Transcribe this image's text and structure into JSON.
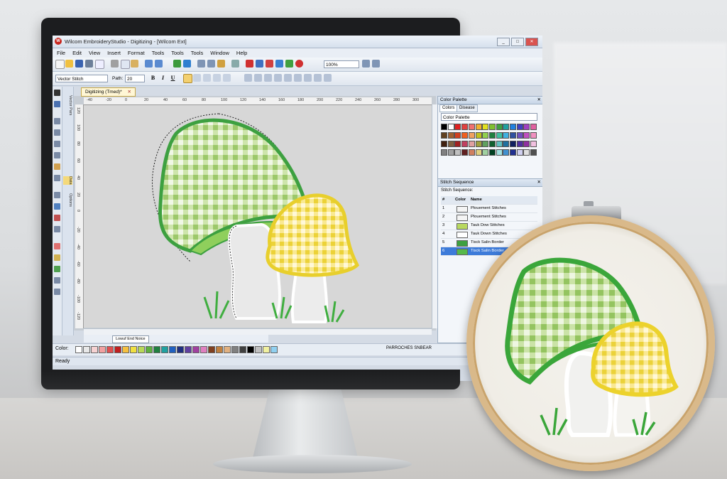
{
  "app": {
    "title": "Wilcom EmbroideryStudio - Digitizing - [Wilcom Ext]",
    "logo_text": "W",
    "window_buttons": [
      "_",
      "□",
      "✕"
    ]
  },
  "menu": [
    "File",
    "Edit",
    "View",
    "Insert",
    "Format",
    "Tools",
    "Tools",
    "Tools",
    "Window",
    "Help"
  ],
  "toolbar": {
    "zoom_value": "100%",
    "stitch_type": "Vector Stitch",
    "path_label": "Path:",
    "path_value": "20",
    "bold": "B",
    "italic": "I",
    "underline": "U"
  },
  "document": {
    "tab_label": "Digitizing (Tmed)*",
    "tab_close": "✕",
    "sheet_tab": "Lowuf End Noice",
    "side_tabs": [
      "Vector Pars",
      "Data",
      "Options"
    ]
  },
  "rulers": {
    "top": [
      "-40",
      "-20",
      "0",
      "20",
      "40",
      "60",
      "80",
      "100",
      "120",
      "140",
      "160",
      "180",
      "200",
      "220",
      "240",
      "260",
      "280",
      "300"
    ],
    "left": [
      "120",
      "100",
      "80",
      "60",
      "40",
      "20",
      "0",
      "-20",
      "-40",
      "-60",
      "-80",
      "-100",
      "-120"
    ]
  },
  "colorbar": {
    "label": "Color:",
    "colors": [
      "#ffffff",
      "#e8e8e8",
      "#f6d2d2",
      "#f2a0a0",
      "#e05050",
      "#c02020",
      "#f5c040",
      "#f0e040",
      "#b8d858",
      "#60b040",
      "#208040",
      "#20a0a0",
      "#2060c0",
      "#203080",
      "#6040a0",
      "#a040a0",
      "#e080c0",
      "#804020",
      "#c08040",
      "#e0b080",
      "#808080",
      "#404040",
      "#000000",
      "#c0c0c0",
      "#f0f0a0",
      "#90d0f0"
    ],
    "right_label": "PARROCHES SNBEAR"
  },
  "status": {
    "text": "Ready"
  },
  "color_palette": {
    "title": "Color Palette",
    "tabs": [
      "Colors",
      "Disease"
    ],
    "dropdown": "Color Palette",
    "swatches": [
      "#000000",
      "#ffffff",
      "#e02020",
      "#e04040",
      "#f07070",
      "#f0b030",
      "#e0e020",
      "#80c030",
      "#40a040",
      "#20a0a0",
      "#2080e0",
      "#4040c0",
      "#a040c0",
      "#e060a0",
      "#604020",
      "#a06030",
      "#d04020",
      "#f06020",
      "#f0a060",
      "#c0c020",
      "#90d050",
      "#208040",
      "#40c0a0",
      "#40b0e0",
      "#3050a0",
      "#7050c0",
      "#c050c0",
      "#f090c0",
      "#402010",
      "#806040",
      "#a02020",
      "#c04060",
      "#e0a0a0",
      "#a0a040",
      "#60a060",
      "#106030",
      "#60c0c0",
      "#2070a0",
      "#102060",
      "#5030a0",
      "#9030a0",
      "#f0c0e0",
      "#808080",
      "#a0a0a0",
      "#c0c0c0",
      "#602020",
      "#d08060",
      "#e0d080",
      "#a0d0a0",
      "#004020",
      "#a0e0e0",
      "#4090d0",
      "#203090",
      "#d0d0f0",
      "#e0e0e0",
      "#505050"
    ]
  },
  "stitch_sequence": {
    "title": "Stitch Sequence",
    "subtitle": "Stitch Sequence:",
    "headers": [
      "#",
      "Color",
      "Name"
    ],
    "rows": [
      {
        "num": "1",
        "swatch": "#f4f4f4",
        "name": "Plouement Stitches"
      },
      {
        "num": "2",
        "swatch": "#f4f4f4",
        "name": "Plouement Stitches"
      },
      {
        "num": "3",
        "swatch": "#b8d860",
        "name": "Tauk Dow Stitches"
      },
      {
        "num": "4",
        "swatch": "#ffffff",
        "name": "Tauk Down Stitches"
      },
      {
        "num": "5",
        "swatch": "#3da040",
        "name": "Tisck Salin Border"
      },
      {
        "num": "6",
        "swatch": "#56b94a",
        "name": "Tisck Salin Border"
      }
    ]
  }
}
